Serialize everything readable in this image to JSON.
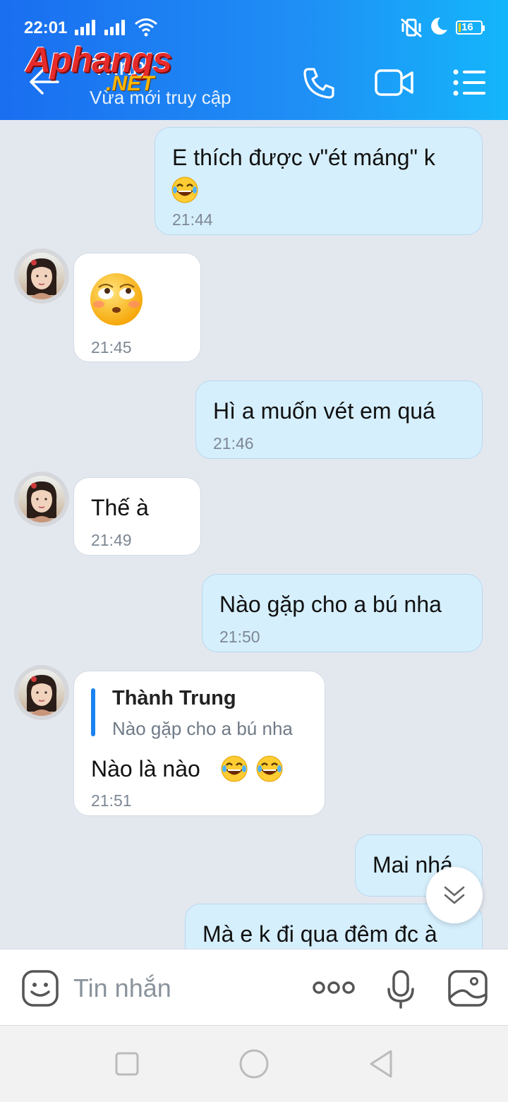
{
  "status_bar": {
    "time": "22:01",
    "battery": "16"
  },
  "header": {
    "contact_name": "Trinh",
    "contact_status": "Vừa mới truy cập",
    "watermark_main": "Aphangs",
    "watermark_sub": ".NET"
  },
  "messages": [
    {
      "direction": "out",
      "text": "E thích được v\"ét máng\" k",
      "time": "21:44"
    },
    {
      "direction": "in",
      "text": "",
      "time": "21:45"
    },
    {
      "direction": "out",
      "text": "Hì a muốn vét em quá",
      "time": "21:46"
    },
    {
      "direction": "in",
      "text": "Thế à",
      "time": "21:49"
    },
    {
      "direction": "out",
      "text": "Nào gặp cho a bú nha",
      "time": "21:50"
    },
    {
      "direction": "in",
      "text": "Nào là nào",
      "time": "21:51",
      "reply_to": {
        "name": "Thành Trung",
        "text": "Nào gặp cho a bú nha"
      }
    },
    {
      "direction": "out",
      "text": "Mai nhá"
    },
    {
      "direction": "out",
      "text": "Mà e k đi qua đêm đc à"
    }
  ],
  "input": {
    "placeholder": "Tin nhắn"
  },
  "colors": {
    "header_start": "#1a6ef0",
    "header_end": "#14b6fb",
    "outgoing_bubble": "#d6effd",
    "incoming_bubble": "#ffffff",
    "reply_accent": "#1a82f0"
  },
  "icons": [
    "back-arrow-icon",
    "phone-icon",
    "video-call-icon",
    "menu-list-icon",
    "scroll-down-icon",
    "sticker-icon",
    "more-icon",
    "microphone-icon",
    "image-icon",
    "recent-apps-icon",
    "home-icon",
    "back-nav-icon"
  ]
}
